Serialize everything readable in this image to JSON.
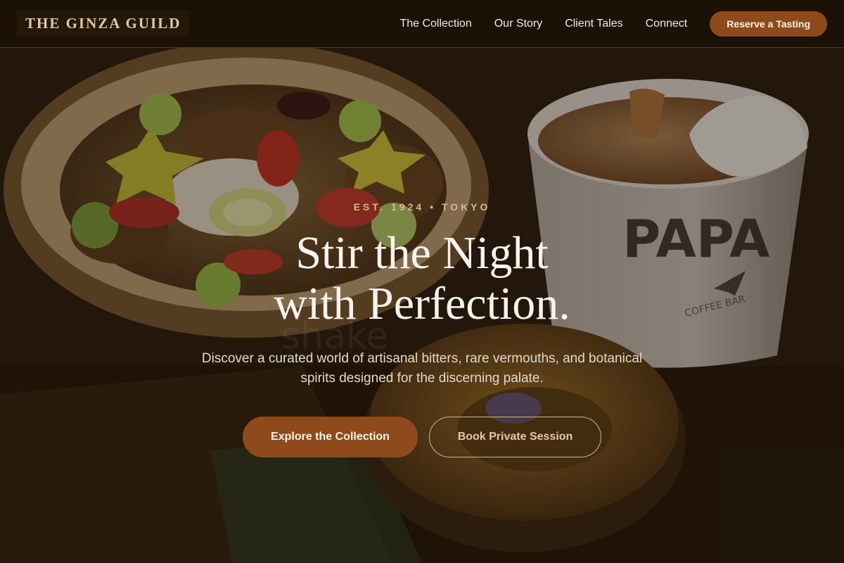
{
  "brand": {
    "name": "THE GINZA GUILD"
  },
  "nav": {
    "items": [
      {
        "label": "The Collection"
      },
      {
        "label": "Our Story"
      },
      {
        "label": "Client Tales"
      },
      {
        "label": "Connect"
      }
    ],
    "reserve_label": "Reserve a Tasting"
  },
  "hero": {
    "eyebrow": "EST. 1924 • TOKYO",
    "headline_line1": "Stir the Night",
    "headline_line2": "with Perfection.",
    "subtext": "Discover a curated world of artisanal bitters, rare vermouths, and botanical spirits designed for the discerning palate.",
    "primary_cta": "Explore the Collection",
    "secondary_cta": "Book Private Session",
    "background_image": {
      "cup_print": "PAPA",
      "cup_subprint": "COFFEE BAR",
      "bowl_print": "shake"
    }
  },
  "colors": {
    "accent": "#8f4a1c",
    "gold": "#e2c79b",
    "nav_bg": "#1b1107"
  }
}
